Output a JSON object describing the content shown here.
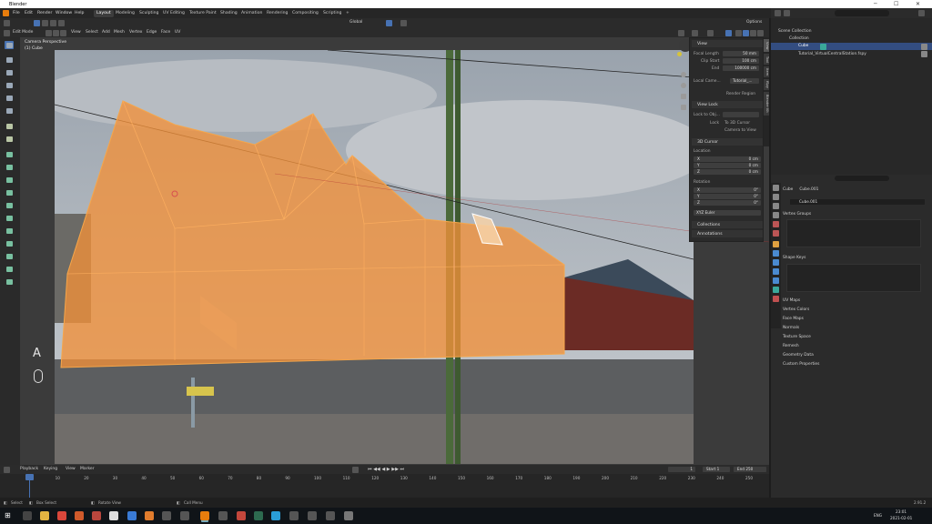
{
  "window": {
    "title": "Blender",
    "minimize": "─",
    "maximize": "☐",
    "close": "✕"
  },
  "menu": [
    "File",
    "Edit",
    "Render",
    "Window",
    "Help"
  ],
  "workspaces": [
    "Layout",
    "Modeling",
    "Sculpting",
    "UV Editing",
    "Texture Paint",
    "Shading",
    "Animation",
    "Rendering",
    "Compositing",
    "Scripting"
  ],
  "scene": {
    "label": "Scene",
    "view_layer": "View Layer"
  },
  "header": {
    "mode": "Edit Mode",
    "view": "View",
    "select": "Select",
    "add": "Add",
    "mesh": "Mesh",
    "vertex": "Vertex",
    "edge": "Edge",
    "face": "Face",
    "uv": "UV",
    "orientation": "Global",
    "options": "Options"
  },
  "viewport": {
    "camera": "Camera Perspective",
    "object": "(1) Cube",
    "letter": "A"
  },
  "npanel": {
    "tabs": [
      "View",
      "Tool",
      "Item",
      "fSpy",
      "Blender Kit"
    ],
    "view_title": "View",
    "focal_label": "Focal Length",
    "focal_value": "50 mm",
    "clip_start_label": "Clip Start",
    "clip_start_value": "100 cm",
    "clip_end_label": "End",
    "clip_end_value": "100000 cm",
    "local_camera_label": "Local Came...",
    "local_camera_value": "Tutorial_...",
    "render_region": "Render Region",
    "view_lock_title": "View Lock",
    "lock_to_obj": "Lock to Obj...",
    "lock_label": "Lock",
    "to_3d_cursor": "To 3D Cursor",
    "camera_to_view": "Camera to View",
    "cursor_title": "3D Cursor",
    "location_label": "Location",
    "rotation_label": "Rotation",
    "loc": [
      {
        "axis": "X",
        "value": "0 cm"
      },
      {
        "axis": "Y",
        "value": "0 cm"
      },
      {
        "axis": "Z",
        "value": "0 cm"
      }
    ],
    "rot": [
      {
        "axis": "X",
        "value": "0°"
      },
      {
        "axis": "Y",
        "value": "0°"
      },
      {
        "axis": "Z",
        "value": "0°"
      }
    ],
    "euler": "XYZ Euler",
    "collections": "Collections",
    "annotations": "Annotations"
  },
  "outliner": {
    "scene_collection": "Scene Collection",
    "collection": "Collection",
    "cube": "Cube",
    "image": "Tutorial_VirtualCentralStation.fspy"
  },
  "properties": {
    "object": "Cube",
    "mesh": "Cube.001",
    "data_name": "Cube.001",
    "sections": [
      "Vertex Groups",
      "Shape Keys",
      "UV Maps",
      "Vertex Colors",
      "Face Maps",
      "Normals",
      "Texture Space",
      "Remesh",
      "Geometry Data",
      "Custom Properties"
    ]
  },
  "timeline": {
    "playback": "Playback",
    "keying": "Keying",
    "view": "View",
    "marker": "Marker",
    "current_frame": "1",
    "start_label": "Start",
    "start_value": "1",
    "end_label": "End",
    "end_value": "250",
    "ticks": [
      "0",
      "10",
      "20",
      "30",
      "40",
      "50",
      "60",
      "70",
      "80",
      "90",
      "100",
      "110",
      "120",
      "130",
      "140",
      "150",
      "160",
      "170",
      "180",
      "190",
      "200",
      "210",
      "220",
      "230",
      "240",
      "250"
    ]
  },
  "status": {
    "select": "Select",
    "box_select": "Box Select",
    "rotate": "Rotate View",
    "call_menu": "Call Menu",
    "version": "2.91.2"
  },
  "taskbar": {
    "lang": "ENG",
    "time": "23:01",
    "date": "2021-02-01"
  }
}
